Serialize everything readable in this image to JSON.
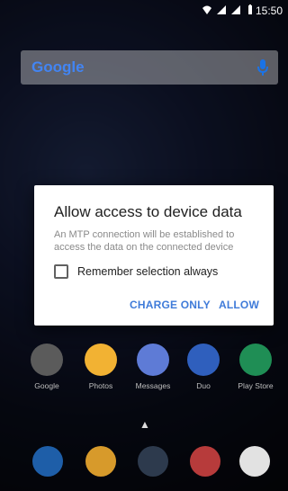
{
  "status": {
    "time": "15:50"
  },
  "search": {
    "logo": "Google"
  },
  "dialog": {
    "title": "Allow access to device data",
    "message": "An MTP connection will be established to access the data on the connected device",
    "checkbox_label": "Remember selection always",
    "checkbox_checked": false,
    "charge_label": "CHARGE ONLY",
    "allow_label": "ALLOW"
  },
  "apps": [
    {
      "label": "Google",
      "icon": "google-folder-icon",
      "color": "#5b5b5b"
    },
    {
      "label": "Photos",
      "icon": "photos-icon",
      "color": "#f2b233"
    },
    {
      "label": "Messages",
      "icon": "messages-icon",
      "color": "#5e7bd6"
    },
    {
      "label": "Duo",
      "icon": "duo-icon",
      "color": "#2f5fbd"
    },
    {
      "label": "Play Store",
      "icon": "play-store-icon",
      "color": "#1f8e55"
    }
  ],
  "dock": [
    {
      "icon": "phone-icon",
      "color": "#1e5ea8"
    },
    {
      "icon": "chrome-icon",
      "color": "#d79a2b"
    },
    {
      "icon": "camera-icon",
      "color": "#2d3a4d"
    },
    {
      "icon": "camera-app-icon",
      "color": "#b73b3b"
    },
    {
      "icon": "gmail-icon",
      "color": "#e2e2e2"
    }
  ],
  "colors": {
    "accent": "#3f7bd9"
  }
}
